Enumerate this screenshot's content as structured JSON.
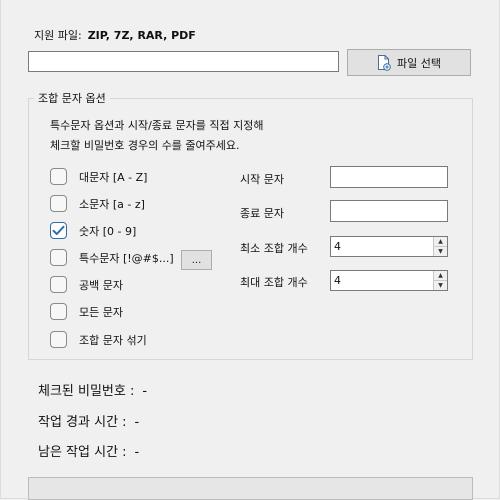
{
  "support": {
    "label": "지원 파일:",
    "formats": "ZIP, 7Z, RAR, PDF"
  },
  "file": {
    "path_value": "",
    "select_button_label": "파일 선택"
  },
  "options": {
    "group_title": "조합 문자 옵션",
    "description_line1": "특수문자 옵션과 시작/종료 문자를 직접 지정해",
    "description_line2": "체크할 비밀번호 경우의 수를 줄여주세요.",
    "checkboxes": [
      {
        "label": "대문자 [A - Z]",
        "checked": false
      },
      {
        "label": "소문자 [a - z]",
        "checked": false
      },
      {
        "label": "숫자 [0 - 9]",
        "checked": true
      },
      {
        "label": "특수문자 [!@#$...]",
        "checked": false
      },
      {
        "label": "공백 문자",
        "checked": false
      },
      {
        "label": "모든 문자",
        "checked": false
      },
      {
        "label": "조합 문자 섞기",
        "checked": false
      }
    ],
    "special_chars_button_label": "...",
    "start_char": {
      "label": "시작 문자",
      "value": ""
    },
    "end_char": {
      "label": "종료 문자",
      "value": ""
    },
    "min_length": {
      "label": "최소 조합 개수",
      "value": "4"
    },
    "max_length": {
      "label": "최대 조합 개수",
      "value": "4"
    }
  },
  "status": {
    "checked_passwords": {
      "label": "체크된 비밀번호 :",
      "value": "-"
    },
    "elapsed_time": {
      "label": "작업 경과 시간 :",
      "value": "-"
    },
    "remaining_time": {
      "label": "남은 작업 시간 :",
      "value": "-"
    }
  },
  "progress": {
    "percent": 0
  },
  "colors": {
    "check_accent": "#2f6ea8",
    "progress_fill": "#06b025"
  },
  "icons": {
    "file_button": "file-add-icon",
    "spinner_up": "triangle-up",
    "spinner_down": "triangle-down",
    "check": "checkmark"
  }
}
